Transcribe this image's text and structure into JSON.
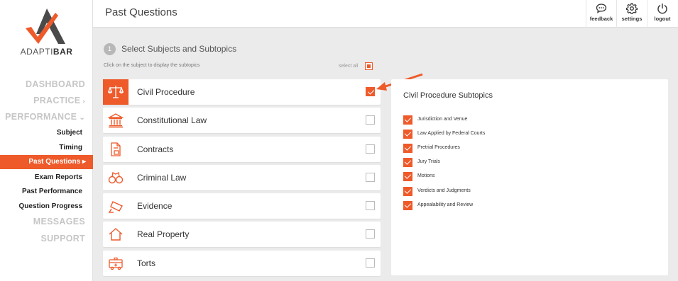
{
  "brand": {
    "name_light": "ADAPTI",
    "name_bold": "BAR",
    "accent": "#ee5a2a"
  },
  "sidebar": {
    "main": [
      {
        "label": "DASHBOARD",
        "chevron": ""
      },
      {
        "label": "PRACTICE",
        "chevron": "›"
      },
      {
        "label": "PERFORMANCE",
        "chevron": "⌄"
      }
    ],
    "performance_sub": [
      "Subject",
      "Timing"
    ],
    "active": "Past Questions ▸",
    "more_sub": [
      "Exam Reports",
      "Past Performance",
      "Question Progress"
    ],
    "bottom": [
      "MESSAGES",
      "SUPPORT"
    ]
  },
  "header": {
    "title": "Past Questions",
    "feedback": "feedback",
    "settings": "settings",
    "logout": "logout"
  },
  "step": {
    "number": "1",
    "title": "Select Subjects and Subtopics",
    "hint": "Click on the subject to display the subtopics",
    "select_all": "select all"
  },
  "subjects": [
    {
      "label": "Civil Procedure",
      "icon": "scales-icon",
      "checked": true,
      "active": true
    },
    {
      "label": "Constitutional Law",
      "icon": "courthouse-icon",
      "checked": false,
      "active": false
    },
    {
      "label": "Contracts",
      "icon": "contract-document-icon",
      "checked": false,
      "active": false
    },
    {
      "label": "Criminal Law",
      "icon": "handcuffs-icon",
      "checked": false,
      "active": false
    },
    {
      "label": "Evidence",
      "icon": "security-camera-icon",
      "checked": false,
      "active": false
    },
    {
      "label": "Real Property",
      "icon": "house-icon",
      "checked": false,
      "active": false
    },
    {
      "label": "Torts",
      "icon": "ambulance-icon",
      "checked": false,
      "active": false
    }
  ],
  "panel": {
    "title": "Civil Procedure Subtopics",
    "topics": [
      "Jurisdiction and Venue",
      "Law Applied by Federal Courts",
      "Pretrial Procedures",
      "Jury Trials",
      "Motions",
      "Verdicts and Judgments",
      "Appealability and Review"
    ]
  }
}
